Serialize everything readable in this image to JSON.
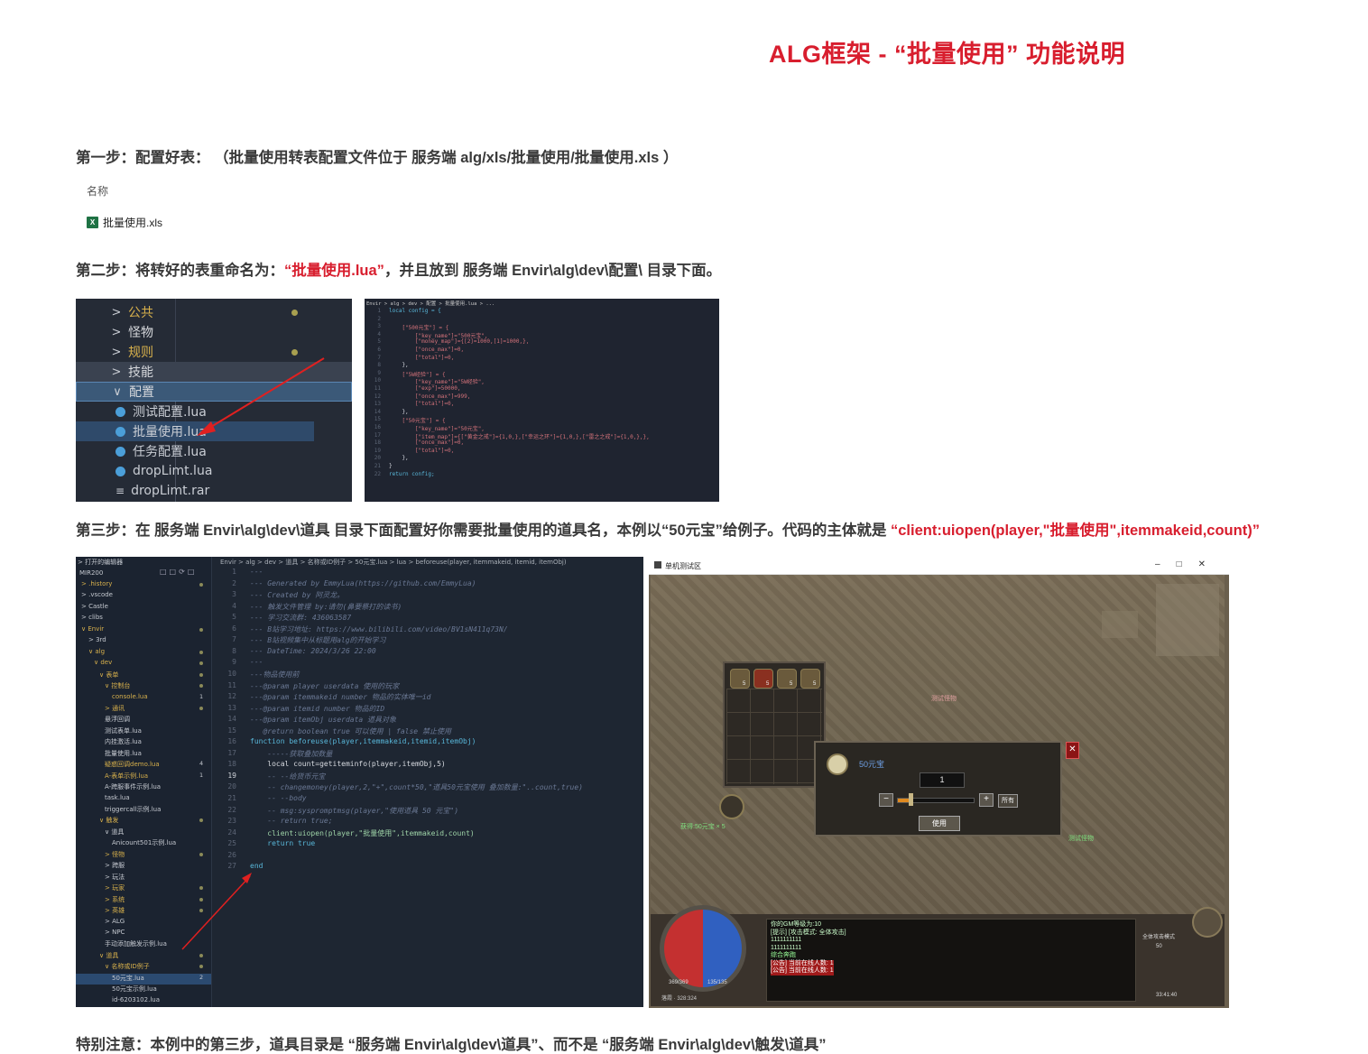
{
  "title": "ALG框架 - “批量使用” 功能说明",
  "step1": {
    "text": "第一步：配置好表：   （批量使用转表配置文件位于 服务端 alg/xls/批量使用/批量使用.xls ）"
  },
  "file_list": {
    "header": "名称",
    "file": "批量使用.xls",
    "icon": "excel-icon"
  },
  "step2": {
    "prefix": "第二步：将转好的表重命名为：",
    "highlight": "“批量使用.lua”",
    "suffix": "，并且放到 服务端 Envir\\alg\\dev\\配置\\ 目录下面。"
  },
  "explorer": {
    "items": [
      {
        "label": "公共",
        "type": "folder"
      },
      {
        "label": "怪物",
        "type": "folder-white"
      },
      {
        "label": "规则",
        "type": "folder"
      },
      {
        "label": "技能",
        "type": "folder-white"
      },
      {
        "label": "配置",
        "type": "folder-open"
      },
      {
        "label": "测试配置.lua",
        "type": "lua"
      },
      {
        "label": "批量使用.lua",
        "type": "lua"
      },
      {
        "label": "任务配置.lua",
        "type": "lua"
      },
      {
        "label": "dropLimt.lua",
        "type": "lua"
      },
      {
        "label": "dropLimt.rar",
        "type": "rar"
      }
    ]
  },
  "config_code": {
    "crumb": "Envir > alg > dev > 配置 > 批量使用.lua > ...",
    "lines": [
      {
        "n": "1",
        "t": "local config = {"
      },
      {
        "n": "2",
        "t": ""
      },
      {
        "n": "3",
        "t": "    [\"500元宝\"] = {"
      },
      {
        "n": "4",
        "t": "        [\"key_name\"]=\"500元宝\","
      },
      {
        "n": "5",
        "t": "        [\"money_map\"]={[2]=1000,[1]=1000,},"
      },
      {
        "n": "6",
        "t": "        [\"once_max\"]=0,"
      },
      {
        "n": "7",
        "t": "        [\"total\"]=0,"
      },
      {
        "n": "8",
        "t": "    },"
      },
      {
        "n": "9",
        "t": "    [\"5W经验\"] = {"
      },
      {
        "n": "10",
        "t": "        [\"key_name\"]=\"5W经验\","
      },
      {
        "n": "11",
        "t": "        [\"exp\"]=50000,"
      },
      {
        "n": "12",
        "t": "        [\"once_max\"]=999,"
      },
      {
        "n": "13",
        "t": "        [\"total\"]=0,"
      },
      {
        "n": "14",
        "t": "    },"
      },
      {
        "n": "15",
        "t": "    [\"50元宝\"] = {"
      },
      {
        "n": "16",
        "t": "        [\"key_name\"]=\"50元宝\","
      },
      {
        "n": "17",
        "t": "        [\"item_map\"]={[\"黄金之戒\"]={1,0,},[\"幸运之环\"]={1,0,},[\"雷之之戒\"]={1,0,},},"
      },
      {
        "n": "18",
        "t": "        [\"once_max\"]=0,"
      },
      {
        "n": "19",
        "t": "        [\"total\"]=0,"
      },
      {
        "n": "20",
        "t": "    },"
      },
      {
        "n": "21",
        "t": "}"
      },
      {
        "n": "22",
        "t": "return config;"
      }
    ]
  },
  "step3": {
    "prefix": "第三步：在 服务端 Envir\\alg\\dev\\道具 目录下面配置好你需要批量使用的道具名，本例以“50元宝”给例子。代码的主体就是 ",
    "highlight": "“client:uiopen(player,\"批量使用\",itemmakeid,count)”"
  },
  "vscode": {
    "side_header": "> 打开的编辑器",
    "project": "MIR200",
    "crumb": "Envir > alg > dev > 道具 > 名称或ID例子 > 50元宝.lua > lua > beforeuse(player, itemmakeid, itemid, itemObj)",
    "tree": [
      {
        "label": "> .history",
        "x": 6,
        "fold": true,
        "dot": true
      },
      {
        "label": "> .vscode",
        "x": 6
      },
      {
        "label": "> Castle",
        "x": 6
      },
      {
        "label": "> clibs",
        "x": 6
      },
      {
        "label": "∨ Envir",
        "x": 6,
        "fold": true,
        "dot": true
      },
      {
        "label": "> 3rd",
        "x": 14
      },
      {
        "label": "∨ alg",
        "x": 14,
        "fold": true,
        "dot": true
      },
      {
        "label": "∨ dev",
        "x": 20,
        "fold": true,
        "dot": true
      },
      {
        "label": "∨ 表单",
        "x": 26,
        "fold": true,
        "dot": true
      },
      {
        "label": "∨ 控制台",
        "x": 32,
        "fold": true,
        "dot": true
      },
      {
        "label": "console.lua",
        "x": 40,
        "fold": true,
        "badge": "1"
      },
      {
        "label": "> 通讯",
        "x": 32,
        "fold": true,
        "dot": true
      },
      {
        "label": "悬浮回调",
        "x": 32
      },
      {
        "label": "测试表单.lua",
        "x": 32
      },
      {
        "label": "内挂激活.lua",
        "x": 32
      },
      {
        "label": "批量使用.lua",
        "x": 32
      },
      {
        "label": "疑惑回调demo.lua",
        "x": 32,
        "fold": true,
        "badge": "4"
      },
      {
        "label": "A-表单示例.lua",
        "x": 32,
        "fold": true,
        "badge": "1"
      },
      {
        "label": "A-跨服事件示例.lua",
        "x": 32
      },
      {
        "label": "task.lua",
        "x": 32
      },
      {
        "label": "triggercall示例.lua",
        "x": 32
      },
      {
        "label": "∨ 触发",
        "x": 26,
        "fold": true,
        "dot": true
      },
      {
        "label": "∨ 道具",
        "x": 32
      },
      {
        "label": "Anicount501示例.lua",
        "x": 40
      },
      {
        "label": "> 怪物",
        "x": 32,
        "fold": true,
        "dot": true
      },
      {
        "label": "> 跨服",
        "x": 32
      },
      {
        "label": "> 玩法",
        "x": 32
      },
      {
        "label": "> 玩家",
        "x": 32,
        "fold": true,
        "dot": true
      },
      {
        "label": "> 系统",
        "x": 32,
        "fold": true,
        "dot": true
      },
      {
        "label": "> 英雄",
        "x": 32,
        "fold": true,
        "dot": true
      },
      {
        "label": "> ALG",
        "x": 32
      },
      {
        "label": "> NPC",
        "x": 32
      },
      {
        "label": "手动添加触发示例.lua",
        "x": 32
      },
      {
        "label": "∨ 道具",
        "x": 26,
        "fold": true,
        "dot": true
      },
      {
        "label": "∨ 名称或ID例子",
        "x": 32,
        "fold": true,
        "dot": true
      },
      {
        "label": "50元宝.lua",
        "x": 40,
        "badge": "2"
      },
      {
        "label": "50元宝示例.lua",
        "x": 40
      },
      {
        "label": "id-6203102.lua",
        "x": 40
      }
    ],
    "lines": [
      {
        "n": "1",
        "t": "---",
        "code": false
      },
      {
        "n": "2",
        "t": "--- Generated by EmmyLua(https://github.com/EmmyLua)",
        "code": false
      },
      {
        "n": "3",
        "t": "--- Created by 阿灵龙。",
        "code": false
      },
      {
        "n": "4",
        "t": "--- 触发文件管理 by:请勿(鼻要祭打的读书)",
        "code": false
      },
      {
        "n": "5",
        "t": "--- 学习交流群: 436063587",
        "code": false
      },
      {
        "n": "6",
        "t": "--- B站学习地址: https://www.bilibili.com/video/BV1sN411q73N/",
        "code": false
      },
      {
        "n": "7",
        "t": "--- B站视频集中从标题用alg的开始学习",
        "code": false
      },
      {
        "n": "8",
        "t": "--- DateTime: 2024/3/26 22:00",
        "code": false
      },
      {
        "n": "9",
        "t": "---",
        "code": false
      },
      {
        "n": "10",
        "t": "---物品使用前",
        "code": false
      },
      {
        "n": "11",
        "t": "---@param player userdata 使用的玩家",
        "code": false
      },
      {
        "n": "12",
        "t": "---@param itemmakeid number 物品的实体唯一id",
        "code": false
      },
      {
        "n": "13",
        "t": "---@param itemid number 物品的ID",
        "code": false
      },
      {
        "n": "14",
        "t": "---@param itemObj userdata 道具对象",
        "code": false
      },
      {
        "n": "15",
        "t": "   @return boolean true 可以使用 | false 禁止使用",
        "code": false
      },
      {
        "n": "16",
        "t": "function beforeuse(player,itemmakeid,itemid,itemObj)",
        "code": true
      },
      {
        "n": "17",
        "t": "    -----获取叠加数量",
        "code": false
      },
      {
        "n": "18",
        "t": "    local count=getiteminfo(player,itemObj,5)",
        "code": true
      },
      {
        "n": "19",
        "t": "    -- --给货币元宝",
        "code": false
      },
      {
        "n": "20",
        "t": "    -- changemoney(player,2,\"+\",count*50,\"道具50元宝使用 叠加数量:\"..count,true)",
        "code": false
      },
      {
        "n": "21",
        "t": "    -- --body",
        "code": false
      },
      {
        "n": "22",
        "t": "    -- msg:syspromptmsg(player,\"使用道具 50 元宝\")",
        "code": false
      },
      {
        "n": "23",
        "t": "    -- return true;",
        "code": false
      },
      {
        "n": "24",
        "t": "    client:uiopen(player,\"批量使用\",itemmakeid,count)",
        "code": true
      },
      {
        "n": "25",
        "t": "    return true",
        "code": true
      },
      {
        "n": "26",
        "t": "",
        "code": true
      },
      {
        "n": "27",
        "t": "end",
        "code": true
      }
    ]
  },
  "game": {
    "window_title": "单机测试区",
    "window_buttons": "–□✕",
    "item_name": "50元宝",
    "quantity": "1",
    "quantity_fraction": 0.15,
    "minus": "−",
    "plus": "+",
    "all_label": "所有",
    "use_label": "使用",
    "close": "✕",
    "slot_counts": [
      "5",
      "5",
      "5",
      "5"
    ],
    "ground_label_1": "获得:50元宝 × 5",
    "ground_label_2": "测试怪物",
    "ground_label_3": "测试怪物",
    "hp": "369/369",
    "mp": "135/135",
    "coords": "落霞 · 328:324",
    "chat": [
      "你的GM等级为:10",
      "[提示] [攻击模式: 全体攻击]",
      "1111111111",
      "1111111111",
      "综合奔跑"
    ],
    "chat_warn": [
      "[公告] 当前在线人数: 1",
      "[公告] 当前在线人数: 1"
    ],
    "mode": "全体攻击模式",
    "level": "50",
    "right_hud": "33:41:40"
  },
  "note": "特别注意：本例中的第三步，道具目录是 “服务端 Envir\\alg\\dev\\道具”、而不是 “服务端 Envir\\alg\\dev\\触发\\道具”"
}
